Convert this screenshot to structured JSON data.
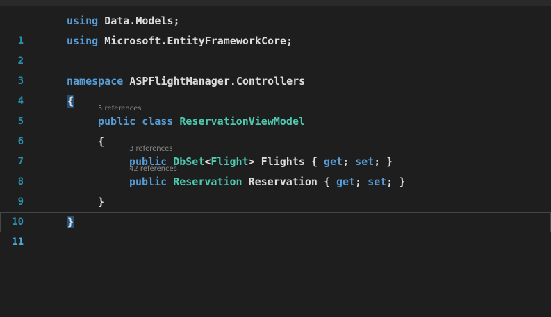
{
  "editor": {
    "lines": [
      {
        "num": "1",
        "parts": [
          "using",
          " ",
          "Data.Models;"
        ]
      },
      {
        "num": "2",
        "parts": [
          "using",
          " ",
          "Microsoft.EntityFrameworkCore;"
        ]
      },
      {
        "num": "3"
      },
      {
        "num": "4",
        "parts": [
          "namespace",
          " ",
          "ASPFlightManager.Controllers"
        ]
      },
      {
        "num": "5",
        "parts": [
          "{"
        ]
      },
      {
        "num": "6",
        "codelens": "5 references",
        "parts": [
          "public",
          " ",
          "class",
          " ",
          "ReservationViewModel"
        ]
      },
      {
        "num": "7",
        "parts": [
          "{"
        ]
      },
      {
        "num": "8",
        "codelens": "3 references",
        "parts": [
          "public",
          " ",
          "DbSet",
          "<",
          "Flight",
          ">",
          " Flights { ",
          "get",
          "; ",
          "set",
          "; }"
        ]
      },
      {
        "num": "9",
        "codelens": "42 references",
        "parts": [
          "public",
          " ",
          "Reservation",
          " Reservation { ",
          "get",
          "; ",
          "set",
          "; }"
        ]
      },
      {
        "num": "10",
        "parts": [
          "}"
        ]
      },
      {
        "num": "11",
        "parts": [
          "}"
        ]
      }
    ]
  },
  "colors": {
    "background": "#1e1e1e",
    "line_number": "#2b91af",
    "keyword": "#569cd6",
    "type": "#4ec9b0",
    "text": "#dcdcdc",
    "codelens": "#8a8a8a",
    "brace_highlight": "#264f78"
  }
}
